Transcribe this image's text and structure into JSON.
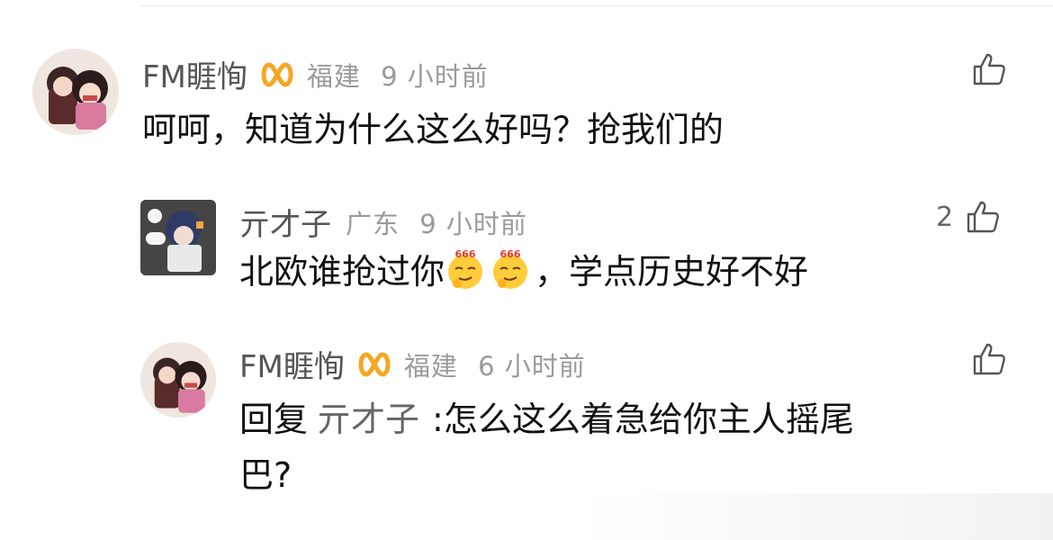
{
  "comments": [
    {
      "username": "FM睚恂",
      "location": "福建",
      "time": "9 小时前",
      "text": "呵呵，知道为什么这么好吗？抢我们的",
      "like_count": ""
    },
    {
      "username": "亓才子",
      "location": "广东",
      "time": "9 小时前",
      "text_before": "北欧谁抢过你",
      "text_after": "，学点历史好不好",
      "like_count": "2",
      "emoji_label": "666"
    },
    {
      "username": "FM睚恂",
      "location": "福建",
      "time": "6 小时前",
      "reply_prefix": "回复",
      "reply_target": "亓才子",
      "text_line1": ":怎么这么着急给你主人摇尾",
      "text_line2": "巴?",
      "like_count": ""
    }
  ],
  "colors": {
    "badge": "#f5a623",
    "username": "#555555",
    "meta": "#9a9a9a",
    "text": "#111111"
  },
  "icons": {
    "like": "thumbs-up-icon",
    "badge": "infinity-badge-icon",
    "emoji": "666-thinking-emoji"
  }
}
